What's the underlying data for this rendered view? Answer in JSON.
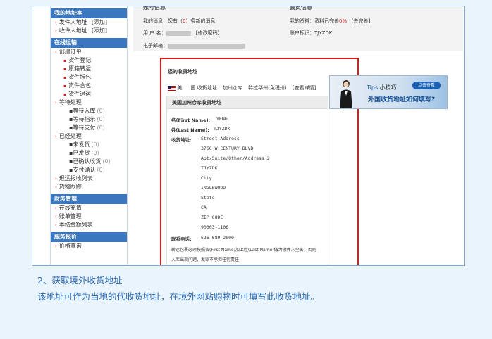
{
  "sidebar": {
    "sections": [
      {
        "title": "我的地址本",
        "items": [
          {
            "label": "发件人地址",
            "link": "[添加]"
          },
          {
            "label": "收件人地址",
            "link": "[添加]"
          }
        ]
      },
      {
        "title": "在线运输",
        "items": [
          {
            "label": "创建订单",
            "level": 1
          },
          {
            "label": "货件登记",
            "level": 2
          },
          {
            "label": "原箱转运",
            "level": 2
          },
          {
            "label": "货件拆包",
            "level": 2
          },
          {
            "label": "货件合包",
            "level": 2
          },
          {
            "label": "货件退运",
            "level": 2
          },
          {
            "label": "等待处理",
            "level": 1
          },
          {
            "label": "等待入库",
            "count": "(0)",
            "level": 3
          },
          {
            "label": "等待指示",
            "count": "(0)",
            "level": 3
          },
          {
            "label": "等待支付",
            "count": "(0)",
            "level": 3
          },
          {
            "label": "已经处理",
            "level": 1
          },
          {
            "label": "未发货",
            "count": "(0)",
            "level": 3
          },
          {
            "label": "已发货",
            "count": "(0)",
            "level": 3
          },
          {
            "label": "已确认收货",
            "count": "(0)",
            "level": 3
          },
          {
            "label": "支付确认",
            "count": "(0)",
            "level": 3
          },
          {
            "label": "退运报收列表",
            "level": 1
          },
          {
            "label": "货物跟踪",
            "level": 1
          }
        ]
      },
      {
        "title": "财务管理",
        "items": [
          {
            "label": "在线充值",
            "level": 1
          },
          {
            "label": "账单管理",
            "level": 1
          },
          {
            "label": "本结金额列表",
            "level": 1
          }
        ]
      },
      {
        "title": "服务报价",
        "items": [
          {
            "label": "价格查询",
            "level": 1
          }
        ]
      }
    ]
  },
  "account": {
    "heading": "账号信息",
    "my_messages_label": "我的消息：",
    "my_messages_pre": "您有（",
    "my_messages_count": "0",
    "my_messages_post": "）条新的消息",
    "username_label": "用 户 名：",
    "change_password": "【修改密码】",
    "email_label": "电子邮箱："
  },
  "member": {
    "heading": "会员信息",
    "profile_label": "我的资料：",
    "profile_pre": "资料已完善",
    "profile_pct": "0%",
    "profile_link": "【去完善】",
    "account_id_label": "账户标识：",
    "account_id": "TJYZDK"
  },
  "receive_address": {
    "title": "您的收货地址",
    "country": "美",
    "country_tail": "国",
    "tab_label": "收货地址",
    "warehouse": "加州仓库",
    "state_note": "特拉华州(免税州)",
    "details_link": "[查看详情]",
    "card_title": "美国加州仓库收货地址",
    "first_name_label": "名(First Name):",
    "first_name": "YENG",
    "last_name_label": "姓(Last Name):",
    "last_name": "TJYZDK",
    "address_label": "收货地址:",
    "lines": [
      {
        "text": "Street Address",
        "red": true
      },
      {
        "text": "3760 W CENTURY BLVD",
        "red": false
      },
      {
        "text": "Apt/Suite/Other/Address 2",
        "red": true
      },
      {
        "text": "TJYZDK",
        "red": false
      },
      {
        "text": "City",
        "red": true
      },
      {
        "text": "INGLEWOOD",
        "red": false
      },
      {
        "text": "State",
        "red": true
      },
      {
        "text": "CA",
        "red": false
      },
      {
        "text": "ZIP CODE",
        "red": true
      },
      {
        "text": "90303-1106",
        "red": false
      }
    ],
    "phone_label": "联系电话:",
    "phone": "626-689-2000",
    "warning_line1": "转运包裹必须按照名(First Name)加上姓(Last Name)做为收件人全名，否则",
    "warning_line2": "入库出现问题，发家不承担任何责任"
  },
  "banner": {
    "tips": "Tips",
    "tips_title": "小技巧",
    "check_button": "点击查看",
    "headline": "外国收货地址如何填写?"
  },
  "captions": {
    "line1": "2、获取境外收货地址",
    "line2": "该地址可作为当地的代收货地址，在境外网站购物时可填写此收货地址。"
  },
  "colors": {
    "accent_blue": "#3a77be",
    "highlight_red": "#e01818",
    "caption_blue": "#2a6ab4"
  }
}
